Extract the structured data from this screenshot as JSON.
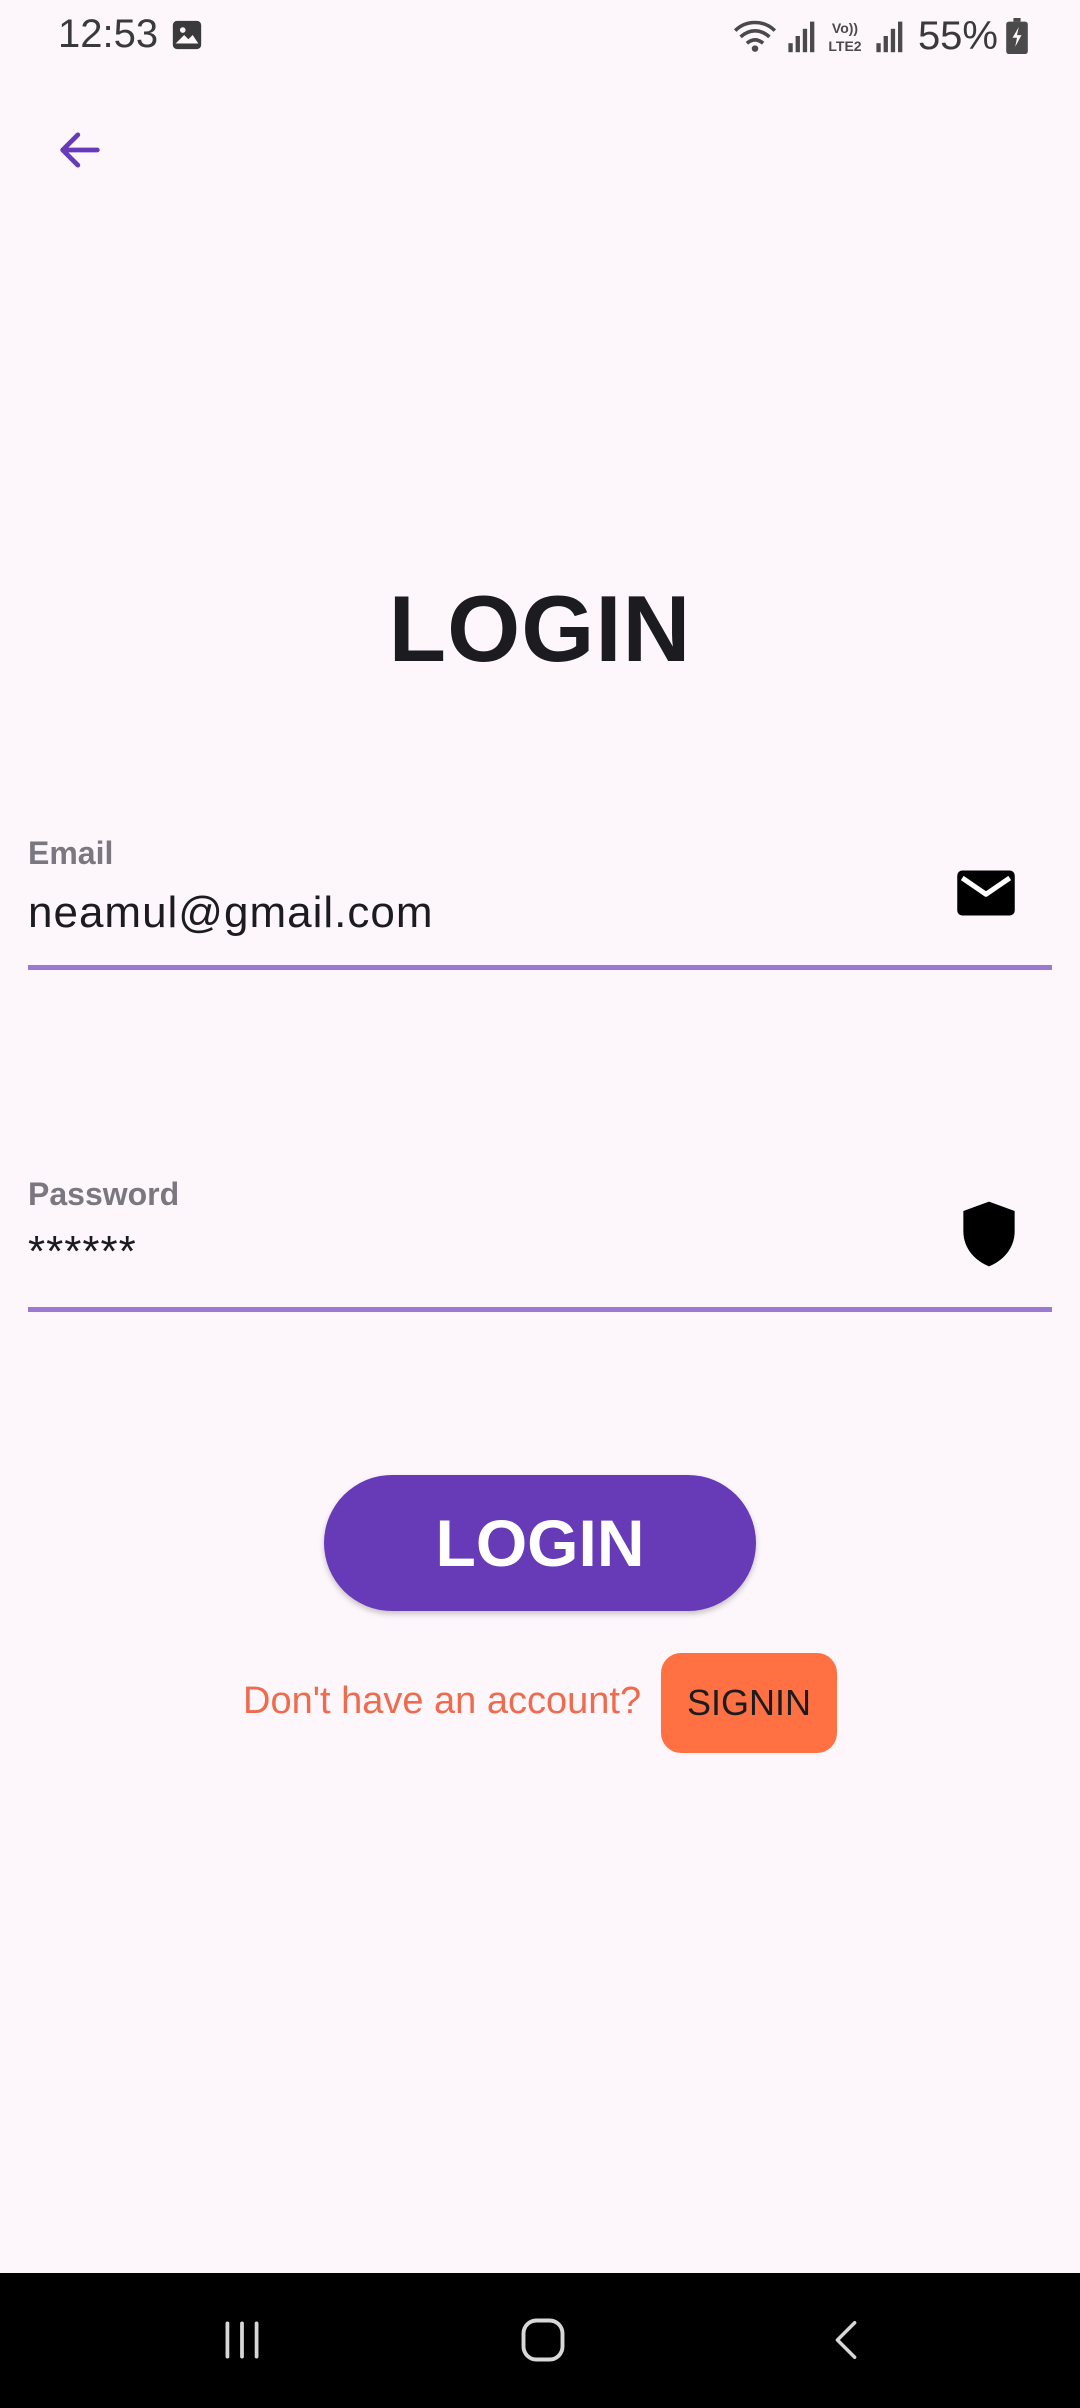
{
  "status_bar": {
    "time": "12:53",
    "battery": "55%",
    "icons": [
      "gallery-icon",
      "wifi-icon",
      "signal-icon",
      "volte-lte2-icon",
      "signal-icon",
      "battery-charging-icon"
    ]
  },
  "app_bar": {
    "back_icon": "arrow-back-icon"
  },
  "title": "LOGIN",
  "form": {
    "email": {
      "label": "Email",
      "value": "neamul@gmail.com",
      "icon": "mail-icon"
    },
    "password": {
      "label": "Password",
      "value": "******",
      "icon": "shield-icon"
    }
  },
  "login_button": "LOGIN",
  "signup": {
    "prompt": "Don't have an account?",
    "button": "SIGNIN"
  },
  "nav_bar": {
    "icons": [
      "recent-apps-icon",
      "home-icon",
      "back-icon"
    ]
  },
  "colors": {
    "background": "#fdf7fc",
    "accent": "#673ab7",
    "underline": "#9a7ad0",
    "prompt_text": "#ee6b4d",
    "signin_bg": "#ff7043"
  }
}
